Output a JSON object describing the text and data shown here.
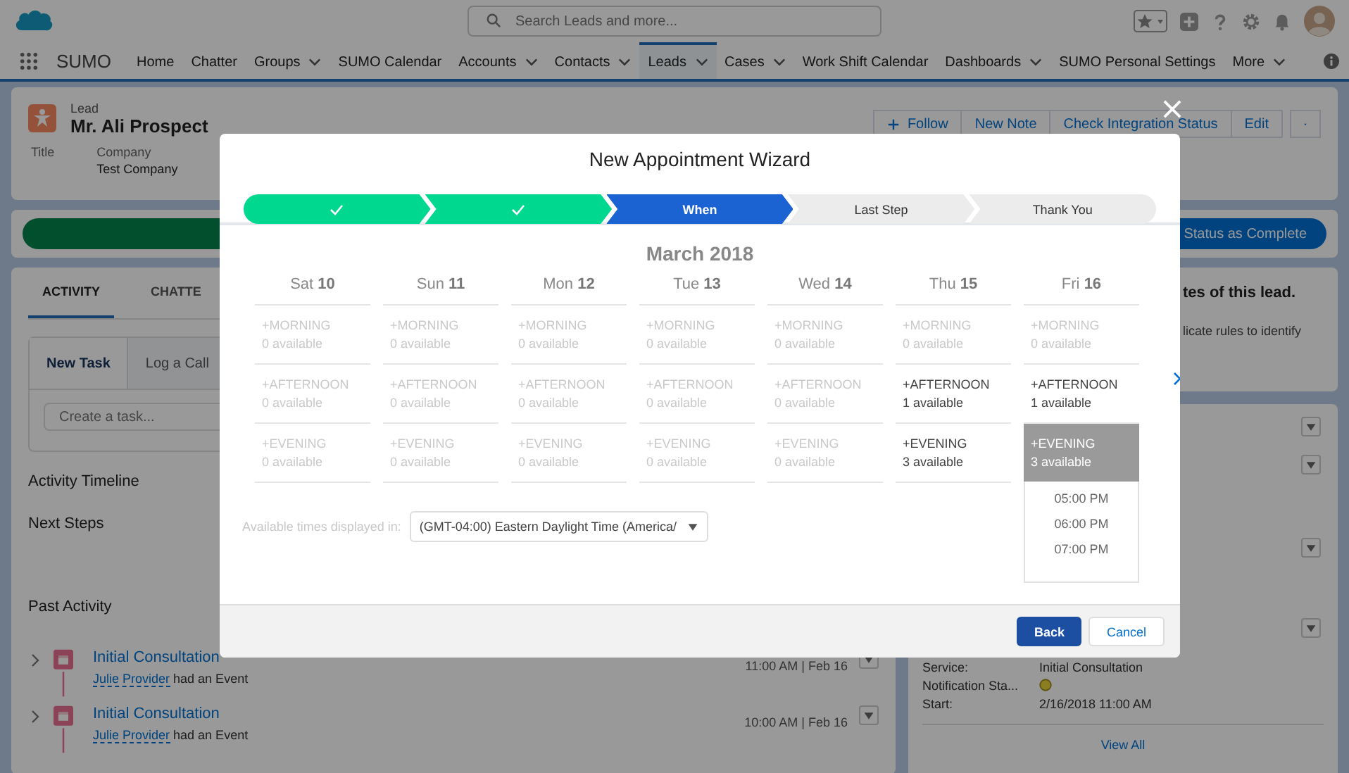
{
  "header": {
    "search": {
      "placeholder": "Search Leads and more..."
    }
  },
  "nav": {
    "app_name": "SUMO",
    "items": [
      {
        "label": "Home",
        "menu": false,
        "selected": false
      },
      {
        "label": "Chatter",
        "menu": false,
        "selected": false
      },
      {
        "label": "Groups",
        "menu": true,
        "selected": false
      },
      {
        "label": "SUMO Calendar",
        "menu": false,
        "selected": false
      },
      {
        "label": "Accounts",
        "menu": true,
        "selected": false
      },
      {
        "label": "Contacts",
        "menu": true,
        "selected": false
      },
      {
        "label": "Leads",
        "menu": true,
        "selected": true
      },
      {
        "label": "Cases",
        "menu": true,
        "selected": false
      },
      {
        "label": "Work Shift Calendar",
        "menu": false,
        "selected": false
      },
      {
        "label": "Dashboards",
        "menu": true,
        "selected": false
      },
      {
        "label": "SUMO Personal Settings",
        "menu": false,
        "selected": false
      },
      {
        "label": "More",
        "menu": true,
        "selected": false
      }
    ]
  },
  "record": {
    "type": "Lead",
    "name": "Mr. Ali Prospect",
    "actions": [
      {
        "label": "Follow",
        "kind": "follow"
      },
      {
        "label": "New Note",
        "kind": "plain"
      },
      {
        "label": "Check Integration Status",
        "kind": "plain"
      },
      {
        "label": "Edit",
        "kind": "plain"
      },
      {
        "kind": "menu"
      }
    ],
    "fields": [
      {
        "label": "Title"
      },
      {
        "label": "Company",
        "value": "Test Company"
      }
    ]
  },
  "path": {
    "button": "Status as Complete"
  },
  "activity": {
    "tabs": [
      {
        "label": "ACTIVITY",
        "selected": true
      },
      {
        "label": "CHATTE",
        "selected": false
      }
    ],
    "composer_tabs": [
      {
        "label": "New Task",
        "selected": true
      },
      {
        "label": "Log a Call",
        "selected": false
      }
    ],
    "task_field": {
      "placeholder": "Create a task..."
    },
    "timeline_heading": "Activity Timeline",
    "next_steps": "Next Steps",
    "past_activity": "Past Activity",
    "events": [
      {
        "title": "Initial Consultation",
        "actor": "Julie Provider",
        "action": "had an Event",
        "time": "11:00 AM | Feb 16"
      },
      {
        "title": "Initial Consultation",
        "actor": "Julie Provider",
        "action": "had an Event",
        "time": "10:00 AM | Feb 16"
      }
    ]
  },
  "side": {
    "duplicate_title": "tes of this lead.",
    "duplicate_text": "licate rules to identify",
    "event_fields": [
      {
        "label": "Service:",
        "kind": "text",
        "value": "Initial Consultation"
      },
      {
        "label": "Notification Sta...",
        "kind": "indicator"
      },
      {
        "label": "Start:",
        "kind": "text",
        "value": "2/16/2018 11:00 AM"
      }
    ],
    "link": "View All"
  },
  "modal": {
    "title": "New Appointment Wizard",
    "steps": [
      {
        "kind": "complete"
      },
      {
        "kind": "complete"
      },
      {
        "label": "When",
        "kind": "current"
      },
      {
        "label": "Last Step",
        "kind": "incomplete"
      },
      {
        "label": "Thank You",
        "kind": "incomplete"
      }
    ],
    "month": "March 2018",
    "days": [
      {
        "weekday": "Sat",
        "date": "10",
        "slots": [
          {
            "label": "+MORNING",
            "count": "0 available",
            "disabled": true,
            "selected": false
          },
          {
            "label": "+AFTERNOON",
            "count": "0 available",
            "disabled": true,
            "selected": false
          },
          {
            "label": "+EVENING",
            "count": "0 available",
            "disabled": true,
            "selected": false
          }
        ]
      },
      {
        "weekday": "Sun",
        "date": "11",
        "slots": [
          {
            "label": "+MORNING",
            "count": "0 available",
            "disabled": true,
            "selected": false
          },
          {
            "label": "+AFTERNOON",
            "count": "0 available",
            "disabled": true,
            "selected": false
          },
          {
            "label": "+EVENING",
            "count": "0 available",
            "disabled": true,
            "selected": false
          }
        ]
      },
      {
        "weekday": "Mon",
        "date": "12",
        "slots": [
          {
            "label": "+MORNING",
            "count": "0 available",
            "disabled": true,
            "selected": false
          },
          {
            "label": "+AFTERNOON",
            "count": "0 available",
            "disabled": true,
            "selected": false
          },
          {
            "label": "+EVENING",
            "count": "0 available",
            "disabled": true,
            "selected": false
          }
        ]
      },
      {
        "weekday": "Tue",
        "date": "13",
        "slots": [
          {
            "label": "+MORNING",
            "count": "0 available",
            "disabled": true,
            "selected": false
          },
          {
            "label": "+AFTERNOON",
            "count": "0 available",
            "disabled": true,
            "selected": false
          },
          {
            "label": "+EVENING",
            "count": "0 available",
            "disabled": true,
            "selected": false
          }
        ]
      },
      {
        "weekday": "Wed",
        "date": "14",
        "slots": [
          {
            "label": "+MORNING",
            "count": "0 available",
            "disabled": true,
            "selected": false
          },
          {
            "label": "+AFTERNOON",
            "count": "0 available",
            "disabled": true,
            "selected": false
          },
          {
            "label": "+EVENING",
            "count": "0 available",
            "disabled": true,
            "selected": false
          }
        ]
      },
      {
        "weekday": "Thu",
        "date": "15",
        "slots": [
          {
            "label": "+MORNING",
            "count": "0 available",
            "disabled": true,
            "selected": false
          },
          {
            "label": "+AFTERNOON",
            "count": "1 available",
            "disabled": false,
            "selected": false
          },
          {
            "label": "+EVENING",
            "count": "3 available",
            "disabled": false,
            "selected": false
          }
        ]
      },
      {
        "weekday": "Fri",
        "date": "16",
        "slots": [
          {
            "label": "+MORNING",
            "count": "0 available",
            "disabled": true,
            "selected": false
          },
          {
            "label": "+AFTERNOON",
            "count": "1 available",
            "disabled": false,
            "selected": false
          },
          {
            "label": "+EVENING",
            "count": "3 available",
            "disabled": false,
            "selected": true,
            "times": [
              "05:00 PM",
              "06:00 PM",
              "07:00 PM"
            ]
          }
        ]
      }
    ],
    "timezone": {
      "label": "Available times displayed in:",
      "value": "(GMT-04:00) Eastern Daylight Time (America/"
    },
    "buttons": [
      {
        "label": "Back",
        "kind": "primary"
      },
      {
        "label": "Cancel",
        "kind": "neutral"
      }
    ]
  }
}
